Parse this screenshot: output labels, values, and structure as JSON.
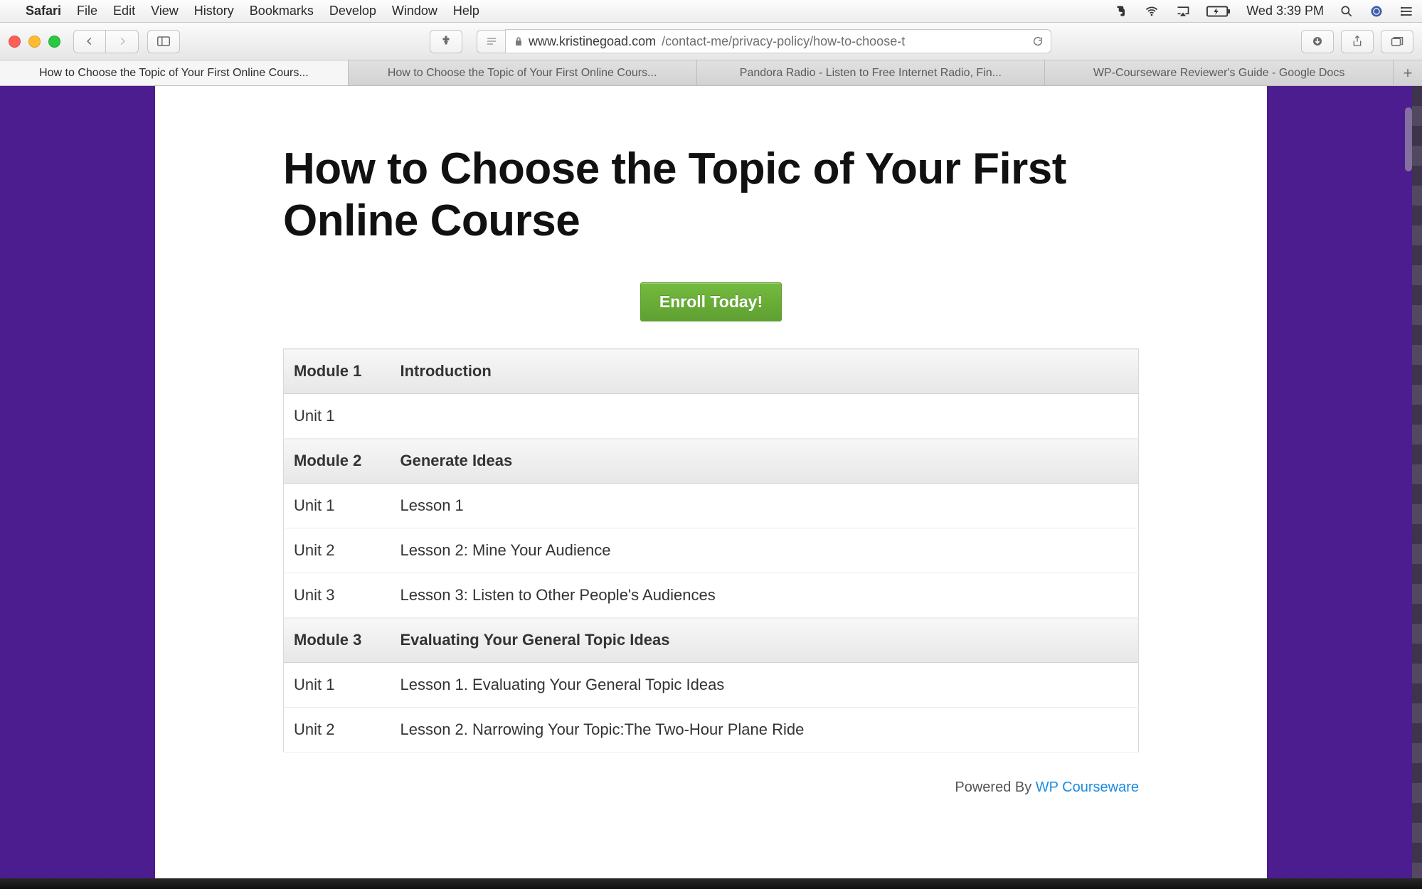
{
  "menubar": {
    "appname": "Safari",
    "items": [
      "File",
      "Edit",
      "View",
      "History",
      "Bookmarks",
      "Develop",
      "Window",
      "Help"
    ],
    "clock": "Wed 3:39 PM"
  },
  "toolbar": {
    "address_host": "www.kristinegoad.com",
    "address_path": "/contact-me/privacy-policy/how-to-choose-t"
  },
  "tabs": [
    {
      "label": "How to Choose the Topic of Your First Online Cours...",
      "active": true
    },
    {
      "label": "How to Choose the Topic of Your First Online Cours...",
      "active": false
    },
    {
      "label": "Pandora Radio - Listen to Free Internet Radio, Fin...",
      "active": false
    },
    {
      "label": "WP-Courseware Reviewer's Guide - Google Docs",
      "active": false
    }
  ],
  "page": {
    "title": "How to Choose the Topic of Your First Online Course",
    "enroll_label": "Enroll Today!",
    "rows": [
      {
        "type": "module",
        "col1": "Module 1",
        "col2": "Introduction"
      },
      {
        "type": "unit",
        "col1": "Unit 1",
        "col2": ""
      },
      {
        "type": "module",
        "col1": "Module 2",
        "col2": "Generate Ideas"
      },
      {
        "type": "unit",
        "col1": "Unit 1",
        "col2": "Lesson 1"
      },
      {
        "type": "unit",
        "col1": "Unit 2",
        "col2": "Lesson 2: Mine Your Audience"
      },
      {
        "type": "unit",
        "col1": "Unit 3",
        "col2": "Lesson 3: Listen to Other People's Audiences"
      },
      {
        "type": "module",
        "col1": "Module 3",
        "col2": "Evaluating Your General Topic Ideas"
      },
      {
        "type": "unit",
        "col1": "Unit 1",
        "col2": "Lesson 1. Evaluating Your General Topic Ideas"
      },
      {
        "type": "unit",
        "col1": "Unit 2",
        "col2": "Lesson 2. Narrowing Your Topic:The Two-Hour Plane Ride"
      }
    ],
    "powered_text": "Powered By ",
    "powered_link": "WP Courseware"
  }
}
